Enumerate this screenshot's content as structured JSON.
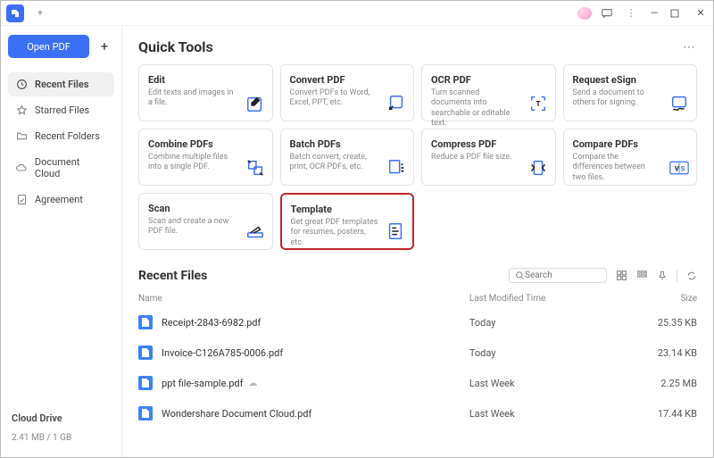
{
  "titlebar": {
    "newtab_glyph": "+"
  },
  "sidebar": {
    "open_pdf_label": "Open PDF",
    "plus_glyph": "+",
    "items": [
      {
        "label": "Recent Files"
      },
      {
        "label": "Starred Files"
      },
      {
        "label": "Recent Folders"
      },
      {
        "label": "Document Cloud"
      },
      {
        "label": "Agreement"
      }
    ],
    "cloud_drive_label": "Cloud Drive",
    "cloud_usage": "2.41 MB / 1 GB"
  },
  "quick_tools": {
    "heading": "Quick Tools",
    "tools": [
      {
        "label": "Edit",
        "desc": "Edit texts and images in a file."
      },
      {
        "label": "Convert PDF",
        "desc": "Convert PDFs to Word, Excel, PPT, etc."
      },
      {
        "label": "OCR PDF",
        "desc": "Turn scanned documents into searchable or editable text."
      },
      {
        "label": "Request eSign",
        "desc": "Send a document to others for signing."
      },
      {
        "label": "Combine PDFs",
        "desc": "Combine multiple files into a single PDF."
      },
      {
        "label": "Batch PDFs",
        "desc": "Batch convert, create, print, OCR PDFs, etc."
      },
      {
        "label": "Compress PDF",
        "desc": "Reduce a PDF file size."
      },
      {
        "label": "Compare PDFs",
        "desc": "Compare the differences between two files."
      },
      {
        "label": "Scan",
        "desc": "Scan and create a new PDF file."
      },
      {
        "label": "Template",
        "desc": "Get great PDF templates for resumes, posters, etc."
      }
    ]
  },
  "recent_files": {
    "heading": "Recent Files",
    "search_placeholder": "Search",
    "columns": {
      "name": "Name",
      "modified": "Last Modified Time",
      "size": "Size"
    },
    "rows": [
      {
        "name": "Receipt-2843-6982.pdf",
        "modified": "Today",
        "size": "25.35 KB",
        "cloud": false
      },
      {
        "name": "Invoice-C126A785-0006.pdf",
        "modified": "Today",
        "size": "23.14 KB",
        "cloud": false
      },
      {
        "name": "ppt file-sample.pdf",
        "modified": "Last Week",
        "size": "2.25 MB",
        "cloud": true
      },
      {
        "name": "Wondershare Document Cloud.pdf",
        "modified": "Last Week",
        "size": "17.44 KB",
        "cloud": false
      }
    ]
  }
}
